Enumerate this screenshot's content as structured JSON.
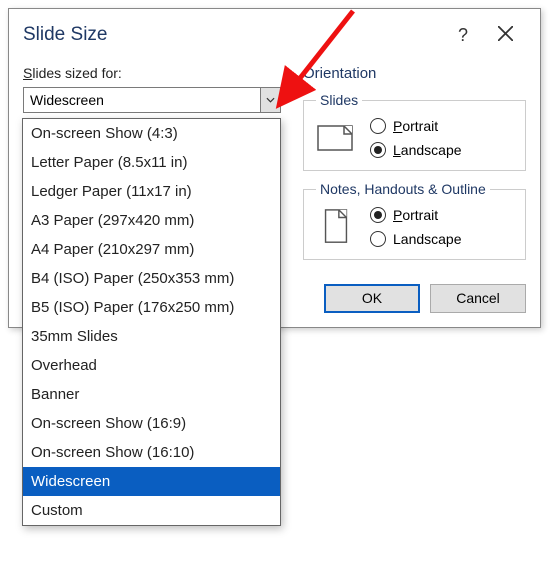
{
  "dialog": {
    "title": "Slide Size",
    "help_symbol": "?",
    "close_name": "close"
  },
  "left": {
    "label_pre": "S",
    "label_rest": "lides sized for:",
    "selected": "Widescreen",
    "options": [
      "On-screen Show (4:3)",
      "Letter Paper (8.5x11 in)",
      "Ledger Paper (11x17 in)",
      "A3 Paper (297x420 mm)",
      "A4 Paper (210x297 mm)",
      "B4 (ISO) Paper (250x353 mm)",
      "B5 (ISO) Paper (176x250 mm)",
      "35mm Slides",
      "Overhead",
      "Banner",
      "On-screen Show (16:9)",
      "On-screen Show (16:10)",
      "Widescreen",
      "Custom"
    ],
    "selected_index": 12
  },
  "orientation": {
    "heading": "Orientation",
    "slides": {
      "legend": "Slides",
      "portrait_pre": "P",
      "portrait_rest": "ortrait",
      "landscape_pre": "L",
      "landscape_rest": "andscape",
      "checked": "landscape"
    },
    "notes": {
      "legend": "Notes, Handouts & Outline",
      "portrait_pre": "P",
      "portrait_rest": "ortrait",
      "landscape": "Landscape",
      "checked": "portrait"
    }
  },
  "buttons": {
    "ok": "OK",
    "cancel": "Cancel"
  }
}
